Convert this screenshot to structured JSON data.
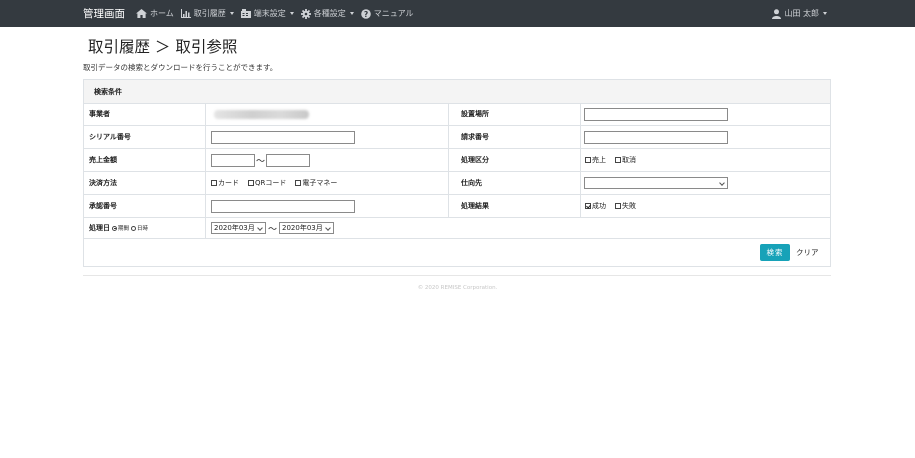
{
  "navbar": {
    "brand": "管理画面",
    "items": [
      {
        "label": "ホーム",
        "icon": "home-icon",
        "dropdown": false
      },
      {
        "label": "取引履歴",
        "icon": "chart-icon",
        "dropdown": true
      },
      {
        "label": "端末設定",
        "icon": "terminal-icon",
        "dropdown": true
      },
      {
        "label": "各種設定",
        "icon": "gear-icon",
        "dropdown": true
      },
      {
        "label": "マニュアル",
        "icon": "question-icon",
        "dropdown": false
      }
    ],
    "user": "山田 太郎"
  },
  "page": {
    "title": "取引履歴 ＞ 取引参照",
    "description": "取引データの検索とダウンロードを行うことができます。"
  },
  "form": {
    "header": "検索条件",
    "business_label": "事業者",
    "install_label": "設置場所",
    "serial_label": "シリアル番号",
    "invoice_label": "請求番号",
    "amount_label": "売上金額",
    "amount_sep": "～",
    "process_type_label": "処理区分",
    "process_types": [
      "売上",
      "取消"
    ],
    "payment_label": "決済方法",
    "payment_methods": [
      "カード",
      "QRコード",
      "電子マネー"
    ],
    "destination_label": "仕向先",
    "destination_value": "",
    "approval_label": "承認番号",
    "result_label": "処理結果",
    "results": [
      {
        "label": "成功",
        "checked": true
      },
      {
        "label": "失敗",
        "checked": false
      }
    ],
    "date_label": "処理日",
    "date_modes": [
      {
        "label": "期間",
        "selected": true
      },
      {
        "label": "日時",
        "selected": false
      }
    ],
    "date_from": "2020年03月",
    "date_sep": "～",
    "date_to": "2020年03月"
  },
  "buttons": {
    "search": "検索",
    "clear": "クリア"
  },
  "colors": {
    "navbar": "#343a40",
    "search_button": "#17a2b8"
  },
  "footer": "© 2020 REMISE Corporation."
}
